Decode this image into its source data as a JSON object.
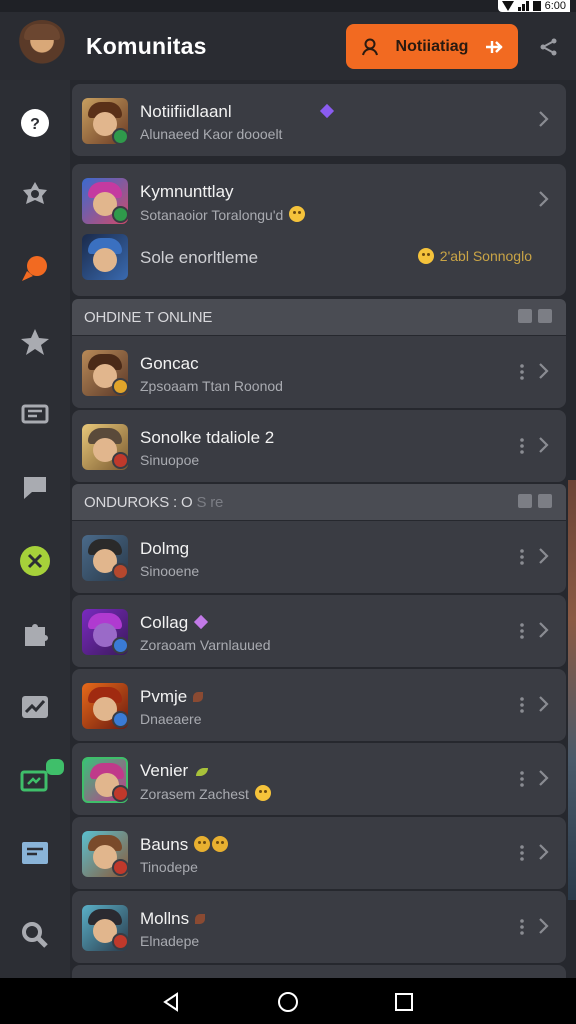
{
  "status_bar": {
    "time": "6:00"
  },
  "header": {
    "title": "Komunitas",
    "notification_button": "Notiiatiag",
    "share_icon": "share-icon"
  },
  "sidebar": [
    {
      "icon": "help-circle-icon",
      "color": "#ffffff"
    },
    {
      "icon": "badge-star-icon",
      "color": "#a9abb1"
    },
    {
      "icon": "chat-bubble-icon",
      "color": "#f26a21",
      "active": true
    },
    {
      "icon": "star-icon",
      "color": "#a9abb1"
    },
    {
      "icon": "message-list-icon",
      "color": "#a9abb1"
    },
    {
      "icon": "comment-icon",
      "color": "#a9abb1"
    },
    {
      "icon": "close-circle-icon",
      "color": "#a6d13a"
    },
    {
      "icon": "puzzle-icon",
      "color": "#a9abb1"
    },
    {
      "icon": "trend-chart-icon",
      "color": "#a9abb1"
    },
    {
      "icon": "game-pad-icon",
      "color": "#3fbf6a",
      "badge": true
    },
    {
      "icon": "notes-icon",
      "color": "#8ab4d8"
    },
    {
      "icon": "search-icon",
      "color": "#a9abb1"
    }
  ],
  "top_items": [
    {
      "name": "Notiifiidlaanl",
      "sub": "Alunaeed Kaor doooelt",
      "badge_color": "#2f9a4b"
    },
    {
      "name": "Kymnunttlay",
      "sub": "Sotanaoior Toralongu'd",
      "badge_color": "#2f9a4b"
    },
    {
      "name": "Sole enorltleme",
      "right_text": "2'abl Sonnoglo"
    }
  ],
  "section_online": {
    "title": "OHDINE T ONLINE",
    "items": [
      {
        "name": "Goncac",
        "sub": "Zpsoaam Ttan Roonod",
        "badge_color": "#e0a42a"
      },
      {
        "name": "Sonolke tdaliole 2",
        "sub": "Sinuopoe",
        "badge_color": "#c0392b"
      }
    ]
  },
  "section_other": {
    "title": "ONDUROKS : O",
    "title_tail": "S re",
    "items": [
      {
        "name": "Dolmg",
        "sub": "Sinooene",
        "badge_color": "#b5482e"
      },
      {
        "name": "Collag",
        "sub": "Zoraoam Varnlauued",
        "badge_color": "#3a7bd5"
      },
      {
        "name": "Pvmje",
        "sub": "Dnaeaere",
        "badge_color": "#3a7bd5"
      },
      {
        "name": "Venier",
        "sub": "Zorasem Zachest",
        "badge_color": "#c0392b"
      },
      {
        "name": "Bauns",
        "sub": "Tinodepe",
        "badge_color": "#c0392b"
      },
      {
        "name": "Mollns",
        "sub": "Elnadepe",
        "badge_color": "#c0392b"
      }
    ]
  }
}
